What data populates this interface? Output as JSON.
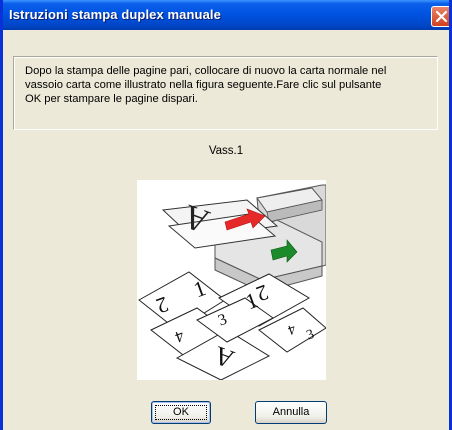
{
  "window": {
    "title": "Istruzioni stampa duplex manuale"
  },
  "message": "Dopo la stampa delle pagine pari, collocare di nuovo la carta normale nel\nvassoio carta come illustrato nella figura seguente.Fare clic sul pulsante\nOK per stampare le pagine dispari.",
  "tray_label": "Vass.1",
  "illustration": {
    "paper_letter": "A",
    "page_numbers": [
      "2",
      "1",
      "4",
      "3"
    ]
  },
  "buttons": {
    "ok": "OK",
    "cancel": "Annulla"
  },
  "colors": {
    "titlebar": "#0054e3",
    "dialog_bg": "#ece9d8",
    "close_button": "#d1411f",
    "arrow_red": "#e62a2a",
    "arrow_green": "#1a8a2a"
  }
}
